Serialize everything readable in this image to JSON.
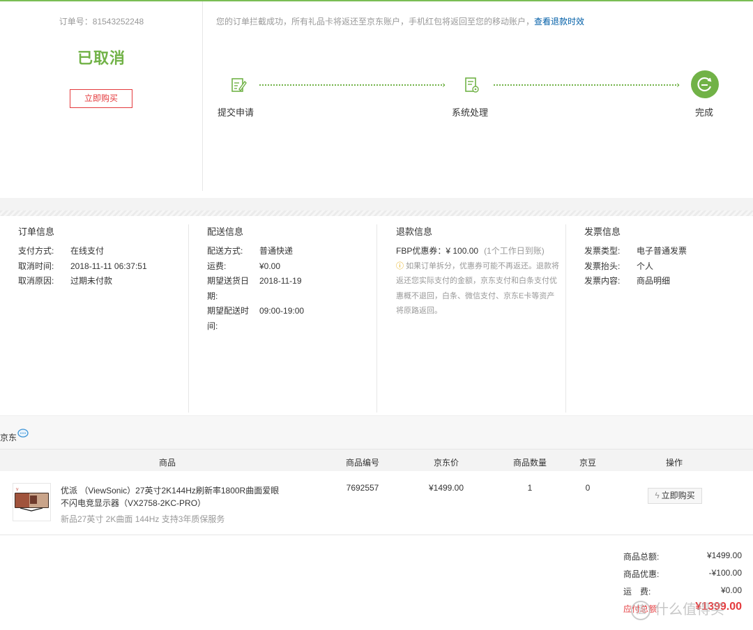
{
  "order": {
    "number_label": "订单号：81543252248",
    "status": "已取消",
    "buy_again": "立即购买"
  },
  "notice": {
    "text": "您的订单拦截成功，所有礼品卡将返还至京东账户，手机红包将返回至您的移动账户，",
    "link": "查看退款时效"
  },
  "progress": {
    "steps": [
      {
        "label": "提交申请",
        "icon": "edit-document-icon"
      },
      {
        "label": "系统处理",
        "icon": "document-gear-icon"
      },
      {
        "label": "完成",
        "icon": "refresh-done-icon"
      }
    ]
  },
  "order_info": {
    "title": "订单信息",
    "rows": [
      {
        "k": "支付方式:",
        "v": "在线支付"
      },
      {
        "k": "取消时间:",
        "v": "2018-11-11 06:37:51"
      },
      {
        "k": "取消原因:",
        "v": "过期未付款"
      }
    ]
  },
  "delivery_info": {
    "title": "配送信息",
    "rows": [
      {
        "k": "配送方式:",
        "v": "普通快递"
      },
      {
        "k": "运费:",
        "v": "¥0.00"
      },
      {
        "k": "期望送货日期:",
        "v": "2018-11-19"
      },
      {
        "k": "期望配送时间:",
        "v": "09:00-19:00"
      }
    ]
  },
  "refund_info": {
    "title": "退款信息",
    "coupon_label": "FBP优惠券：",
    "coupon_amount": "¥ 100.00",
    "coupon_note": "(1个工作日到账)",
    "note": "如果订单拆分，优惠券可能不再返还。退款将返还您实际支付的金额，京东支付和白条支付优惠概不退回，白条、微信支付、京东E卡等资产将原路返回。"
  },
  "invoice_info": {
    "title": "发票信息",
    "rows": [
      {
        "k": "发票类型:",
        "v": "电子普通发票"
      },
      {
        "k": "发票抬头:",
        "v": "个人"
      },
      {
        "k": "发票内容:",
        "v": "商品明细"
      }
    ]
  },
  "shop": {
    "name": "京东"
  },
  "table": {
    "headers": [
      "商品",
      "商品编号",
      "京东价",
      "商品数量",
      "京豆",
      "操作"
    ],
    "rows": [
      {
        "name": "优派 （ViewSonic）27英寸2K144Hz刷新率1800R曲面爱眼不闪电竞显示器（VX2758-2KC-PRO）",
        "subtitle": "新品27英寸 2K曲面 144Hz 支持3年质保服务",
        "sku": "7692557",
        "price": "¥1499.00",
        "qty": "1",
        "beans": "0",
        "action": "立即购买"
      }
    ]
  },
  "totals": [
    {
      "k": "商品总额:",
      "v": "¥1499.00"
    },
    {
      "k": "商品优惠:",
      "v": "-¥100.00"
    },
    {
      "k": "运　费:",
      "v": "¥0.00"
    },
    {
      "k": "应付总额:",
      "v": "¥1399.00"
    }
  ],
  "watermark": {
    "logo": "值",
    "text": "什么值得买"
  },
  "colors": {
    "accent_green": "#71b247",
    "accent_red": "#e4393c",
    "link_blue": "#005ea7"
  }
}
